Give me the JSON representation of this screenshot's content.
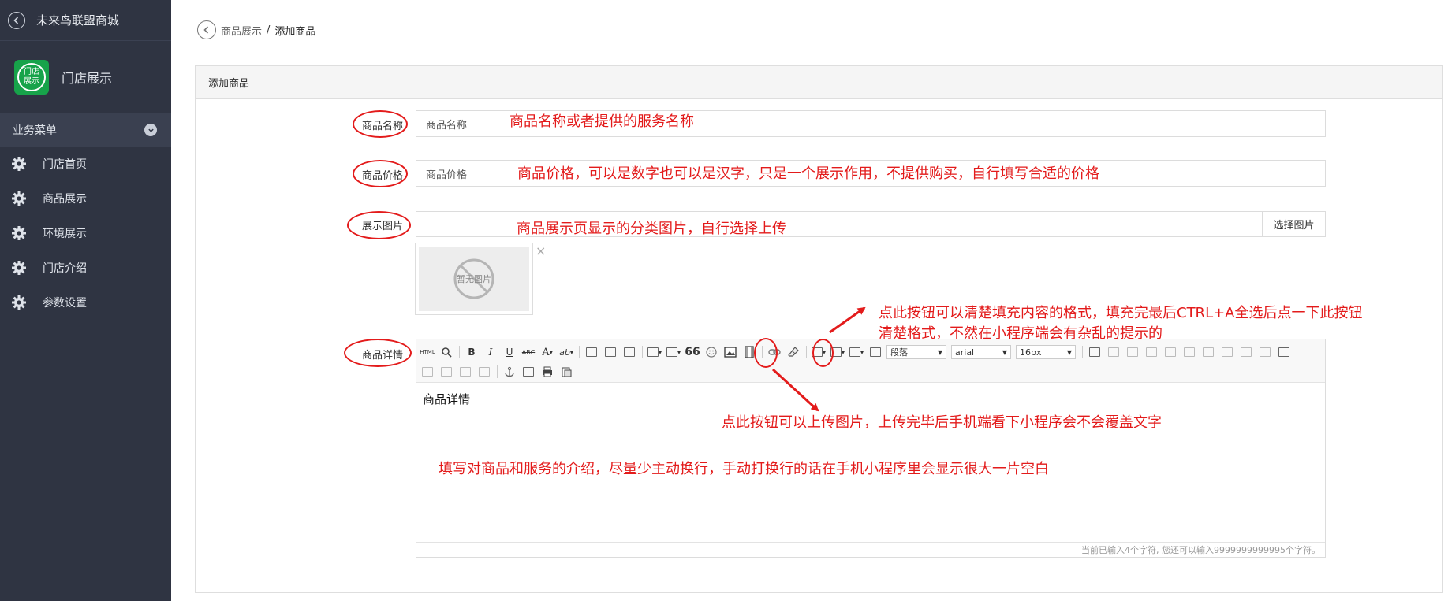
{
  "sidebar": {
    "title": "未来鸟联盟商城",
    "store_logo_text": [
      "门店",
      "展示"
    ],
    "store_name": "门店展示",
    "section_label": "业务菜单",
    "items": [
      {
        "label": "门店首页",
        "icon": "gear-icon"
      },
      {
        "label": "商品展示",
        "icon": "gear-icon"
      },
      {
        "label": "环境展示",
        "icon": "gear-icon"
      },
      {
        "label": "门店介绍",
        "icon": "gear-icon"
      },
      {
        "label": "参数设置",
        "icon": "gear-icon"
      }
    ]
  },
  "breadcrumb": {
    "parent": "商品展示",
    "separator": "/",
    "current": "添加商品"
  },
  "panel": {
    "title": "添加商品"
  },
  "form": {
    "name": {
      "label": "商品名称",
      "placeholder": "商品名称"
    },
    "price": {
      "label": "商品价格",
      "placeholder": "商品价格"
    },
    "image": {
      "label": "展示图片",
      "button": "选择图片",
      "placeholder_image_text": "暂无图片",
      "remove": "×"
    },
    "detail": {
      "label": "商品详情"
    }
  },
  "editor": {
    "toolbar": {
      "html": "HTML",
      "bold": "B",
      "italic": "I",
      "underline": "U",
      "strike": "ABC",
      "font_color": "A",
      "quote": "66",
      "paragraph_select": "段落",
      "font_family_select": "arial",
      "font_size_select": "16px"
    },
    "content": "商品详情",
    "counter": "当前已输入4个字符, 您还可以输入9999999999995个字符。"
  },
  "annotations": {
    "name": "商品名称或者提供的服务名称",
    "price": "商品价格，可以是数字也可以是汉字，只是一个展示作用，不提供购买，自行填写合适的价格",
    "image": "商品展示页显示的分类图片，自行选择上传",
    "clear_format_line1": "点此按钮可以清楚填充内容的格式，填充完最后CTRL+A全选后点一下此按钮",
    "clear_format_line2": "清楚格式，不然在小程序端会有杂乱的提示的",
    "upload_image": "点此按钮可以上传图片，上传完毕后手机端看下小程序会不会覆盖文字",
    "detail": "填写对商品和服务的介绍，尽量少主动换行，手动打换行的话在手机小程序里会显示很大一片空白"
  },
  "colors": {
    "sidebar_bg": "#2f3442",
    "annotation_red": "#e31b1b",
    "logo_green": "#17a34a"
  }
}
